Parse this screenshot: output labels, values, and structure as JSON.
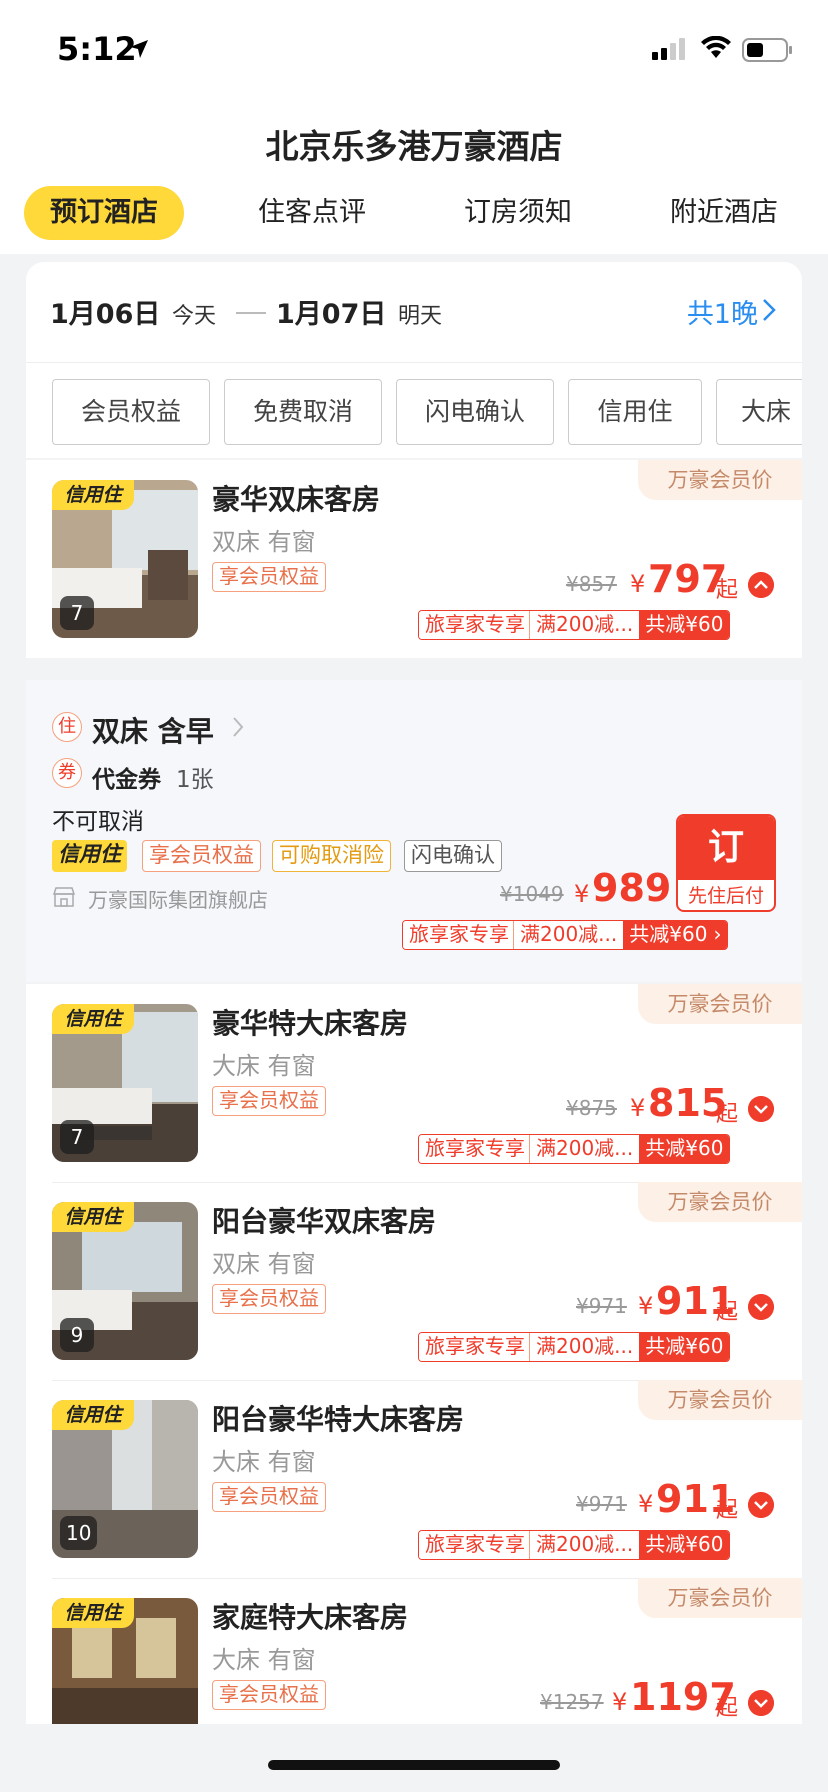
{
  "status_bar": {
    "time": "5:12"
  },
  "header": {
    "title": "北京乐多港万豪酒店",
    "tabs": [
      "预订酒店",
      "住客点评",
      "订房须知",
      "附近酒店"
    ]
  },
  "dates": {
    "checkin": "1月06日",
    "checkin_label": "今天",
    "checkout": "1月07日",
    "checkout_label": "明天",
    "nights": "共1晚"
  },
  "filters": [
    "会员权益",
    "免费取消",
    "闪电确认",
    "信用住",
    "大床"
  ],
  "common": {
    "credit_tag": "信用住",
    "member_price": "万豪会员价",
    "benefit": "享会员权益",
    "yen": "¥",
    "qi": "起",
    "promo_name": "旅享家专享",
    "promo_rule": "满200减...",
    "promo_total": "共减¥60"
  },
  "rooms": [
    {
      "name": "豪华双床客房",
      "sub": "双床 有窗",
      "orig": "¥857",
      "price": "797",
      "count": "7",
      "expanded": true
    },
    {
      "name": "豪华特大床客房",
      "sub": "大床 有窗",
      "orig": "¥875",
      "price": "815",
      "count": "7",
      "expanded": false
    },
    {
      "name": "阳台豪华双床客房",
      "sub": "双床 有窗",
      "orig": "¥971",
      "price": "911",
      "count": "9",
      "expanded": false
    },
    {
      "name": "阳台豪华特大床客房",
      "sub": "大床 有窗",
      "orig": "¥971",
      "price": "911",
      "count": "10",
      "expanded": false
    },
    {
      "name": "家庭特大床客房",
      "sub": "大床 有窗",
      "orig": "¥1257",
      "price": "1197",
      "count": "",
      "expanded": false
    }
  ],
  "rate_plan": {
    "stay_icon": "住",
    "title": "双床  含早",
    "voucher_icon": "券",
    "voucher": "代金券",
    "voucher_count": "1张",
    "cancel": "不可取消",
    "tags": [
      "信用住",
      "享会员权益",
      "可购取消险",
      "闪电确认"
    ],
    "store": "万豪国际集团旗舰店",
    "orig": "¥1049",
    "yen": "¥",
    "price": "989",
    "book": "订",
    "book_sub": "先住后付",
    "promo_total": "共减¥60"
  },
  "colors": {
    "accent_yellow": "#ffd83a",
    "price_red": "#f03c2b",
    "link_blue": "#2a8df0"
  }
}
